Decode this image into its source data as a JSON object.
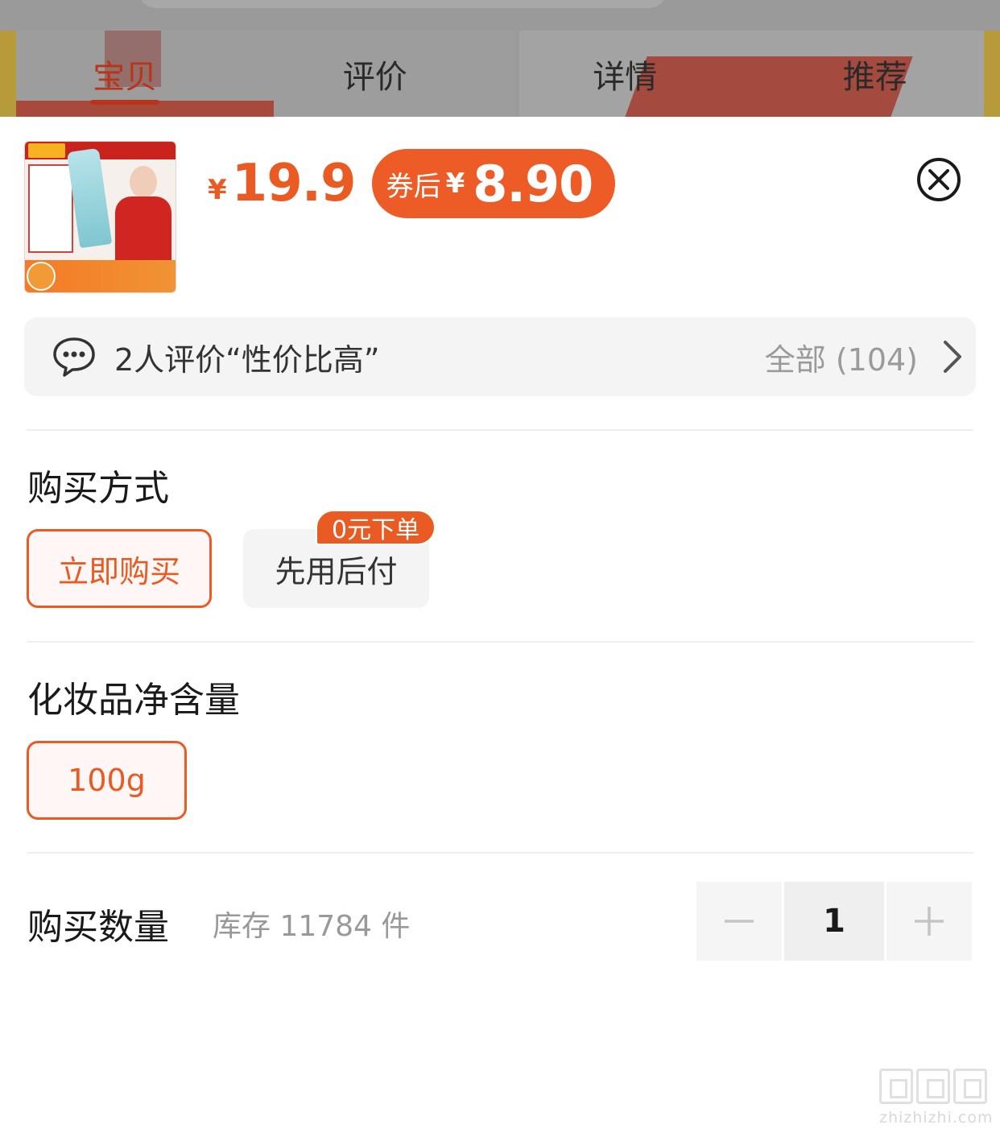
{
  "tabs": [
    {
      "label": "宝贝",
      "active": true
    },
    {
      "label": "评价",
      "active": false
    },
    {
      "label": "详情",
      "active": false
    },
    {
      "label": "推荐",
      "active": false
    }
  ],
  "product": {
    "price_symbol": "¥",
    "price": "19.9",
    "coupon_label": "券后",
    "coupon_symbol": "¥",
    "coupon_price": "8.90"
  },
  "review": {
    "summary": "2人评价“性价比高”",
    "all_label": "全部 (104)"
  },
  "purchase_method": {
    "title": "购买方式",
    "options": [
      {
        "label": "立即购买",
        "selected": true
      },
      {
        "label": "先用后付",
        "selected": false,
        "tag": "0元下单"
      }
    ]
  },
  "volume": {
    "title": "化妆品净含量",
    "options": [
      {
        "label": "100g",
        "selected": true
      }
    ]
  },
  "quantity": {
    "title": "购买数量",
    "stock": "库存 11784 件",
    "value": "1"
  },
  "watermark": {
    "text": "zhizhizhi.com"
  },
  "colors": {
    "accent": "#ea5a23",
    "tab_active": "#b8351c"
  }
}
